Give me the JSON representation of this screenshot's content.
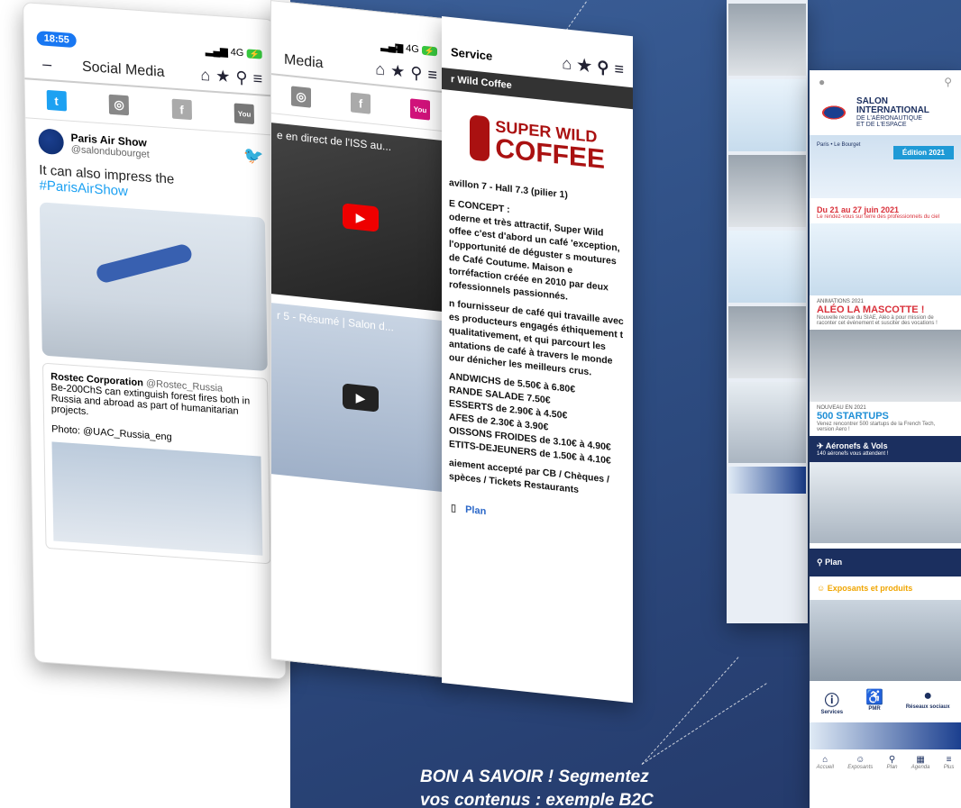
{
  "phone_social": {
    "time": "18:55",
    "network": "4G",
    "title": "Social Media",
    "tweet_name": "Paris Air Show",
    "tweet_handle": "@salondubourget",
    "tweet_text": "It can also impress the ",
    "tweet_tag": "#ParisAirShow",
    "quote_name": "Rostec Corporation",
    "quote_handle": "@Rostec_Russia",
    "quote_text": "Be-200ChS can extinguish forest fires both in Russia and abroad as part of humanitarian projects.",
    "quote_photo": "Photo: @UAC_Russia_eng",
    "social_icons": [
      "twitter-icon",
      "instagram-icon",
      "facebook-icon",
      "youtube-icon"
    ]
  },
  "phone_video": {
    "network": "4G",
    "title": "Media",
    "video1": "e en direct de l'ISS au...",
    "video2": "r 5 - Résumé | Salon d..."
  },
  "phone_service": {
    "title": "Service",
    "band": "r Wild Coffee",
    "logo_line1": "SUPER WILD",
    "logo_line2": "COFFEE",
    "location": "avillon 7 - Hall 7.3 (pilier 1)",
    "concept_label": "E CONCEPT :",
    "concept_text": "oderne et très attractif, Super Wild offee c'est d'abord un café 'exception, l'opportunité de déguster s moutures de Café Coutume. Maison e torréfaction créée en 2010 par deux rofessionnels passionnés.",
    "supplier_text": "n fournisseur de café qui travaille avec es producteurs engagés éthiquement t qualitativement, et qui parcourt les antations de café à travers le monde our dénicher les meilleurs crus.",
    "prices": [
      "ANDWICHS de 5.50€ à 6.80€",
      "RANDE SALADE 7.50€",
      "ESSERTS de 2.90€ à 4.50€",
      "AFES de 2.30€ à 3.90€",
      "OISSONS FROIDES de 3.10€ à 4.90€",
      "ETITS-DEJEUNERS de 1.50€ à 4.10€"
    ],
    "payment": "aiement accepté par CB / Chèques / spèces / Tickets Restaurants",
    "plan_label": "Plan"
  },
  "phone_app": {
    "brand_line1": "SALON",
    "brand_line2": "INTERNATIONAL",
    "brand_line3": "DE L'AÉRONAUTIQUE",
    "brand_line4": "ET DE L'ESPACE",
    "hero_sub": "Paris • Le Bourget",
    "edition": "Édition 2021",
    "dates": "Du 21 au 27 juin 2021",
    "dates_sub": "Le rendez-vous sur terre des professionnels du ciel",
    "anim_kicker": "ANIMATIONS 2021",
    "anim_title": "ALÉO LA MASCOTTE !",
    "anim_sub": "Nouvelle recrue du SIAE, Aléo à pour mission de raconter cet événement et susciter des vocations !",
    "new_kicker": "NOUVEAU EN 2021",
    "new_title": "500 STARTUPS",
    "new_sub": "Venez rencontrer 500 startups de la French Tech, version Aero !",
    "aero_title": "Aéronefs & Vols",
    "aero_sub": "140 aéronefs vous attendent !",
    "plan": "Plan",
    "expo": "Exposants et produits",
    "services": "Services",
    "pmr": "PMR",
    "reseaux": "Réseaux sociaux",
    "nav": [
      "Accueil",
      "Exposants",
      "Plan",
      "Agenda",
      "Plus"
    ]
  },
  "callout": {
    "line1": "BON A SAVOIR !  Segmentez",
    "line2": "vos contenus : exemple B2C"
  },
  "colors": {
    "stage": "#2e4d82",
    "accent_red": "#d9303a",
    "accent_blue": "#1f8fd6",
    "navy": "#1b2f5f"
  }
}
